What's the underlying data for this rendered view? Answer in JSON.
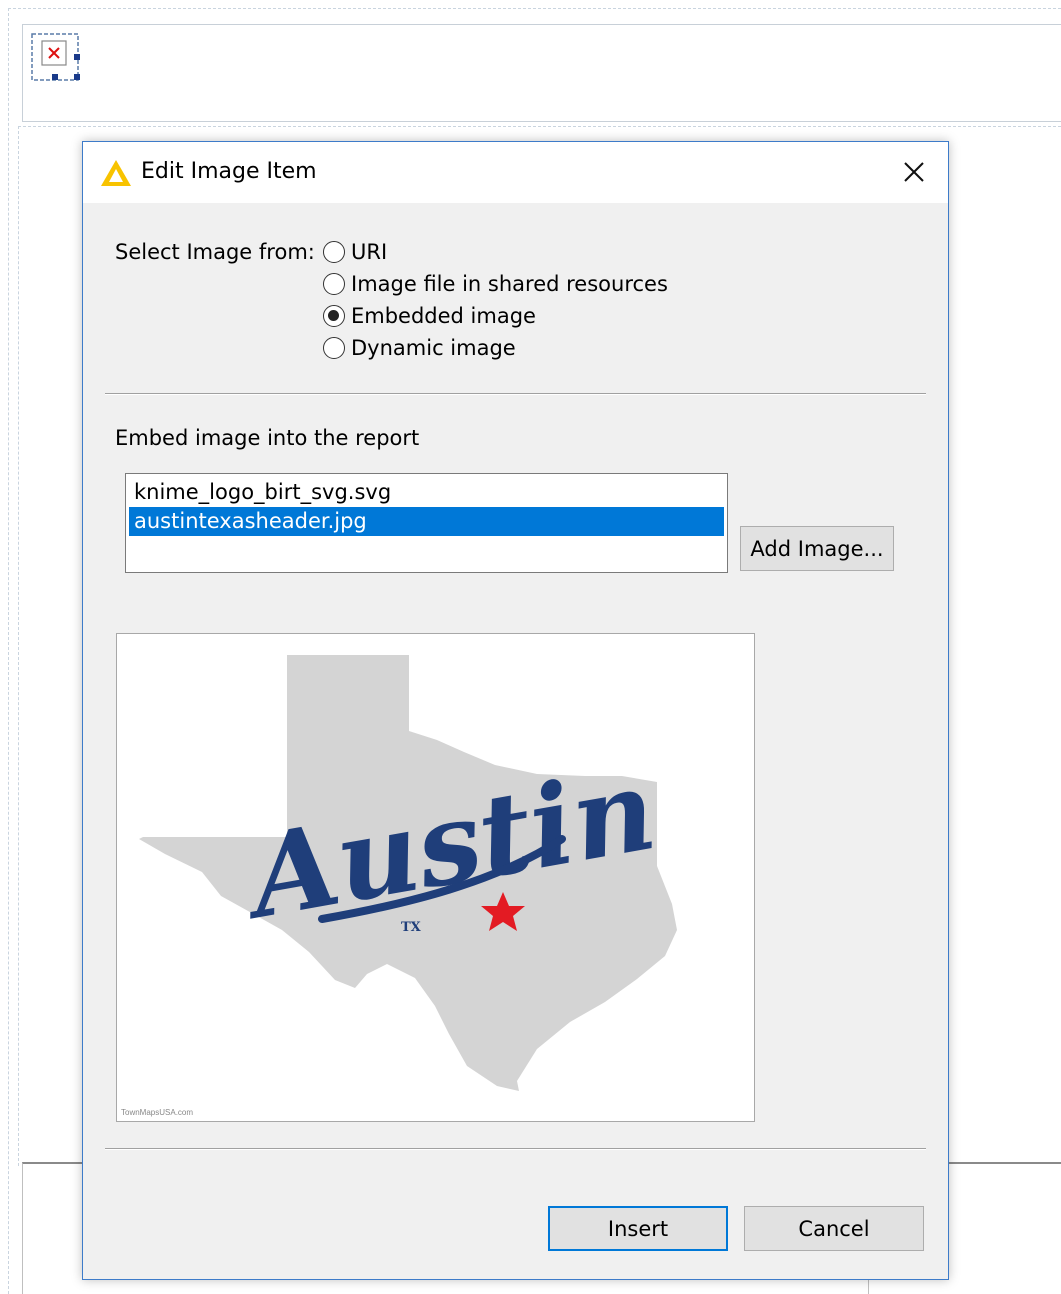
{
  "dialog": {
    "title": "Edit Image Item",
    "select_label": "Select Image from:",
    "source_options": [
      {
        "label": "URI",
        "checked": false
      },
      {
        "label": "Image file in shared resources",
        "checked": false
      },
      {
        "label": "Embedded image",
        "checked": true
      },
      {
        "label": "Dynamic image",
        "checked": false
      }
    ],
    "embed_label": "Embed image into the report",
    "images": [
      {
        "name": "knime_logo_birt_svg.svg",
        "selected": false
      },
      {
        "name": "austintexasheader.jpg",
        "selected": true
      }
    ],
    "add_image_label": "Add Image...",
    "preview": {
      "script_text": "Austin",
      "state_text": "TX",
      "credit": "TownMapsUSA.com",
      "star_color": "#e31b23",
      "script_color": "#1f3e7a",
      "map_color": "#d4d4d4"
    },
    "insert_label": "Insert",
    "cancel_label": "Cancel"
  },
  "icons": {
    "title": "warning-triangle-icon",
    "close": "close-icon",
    "placeholder": "broken-image-icon"
  }
}
